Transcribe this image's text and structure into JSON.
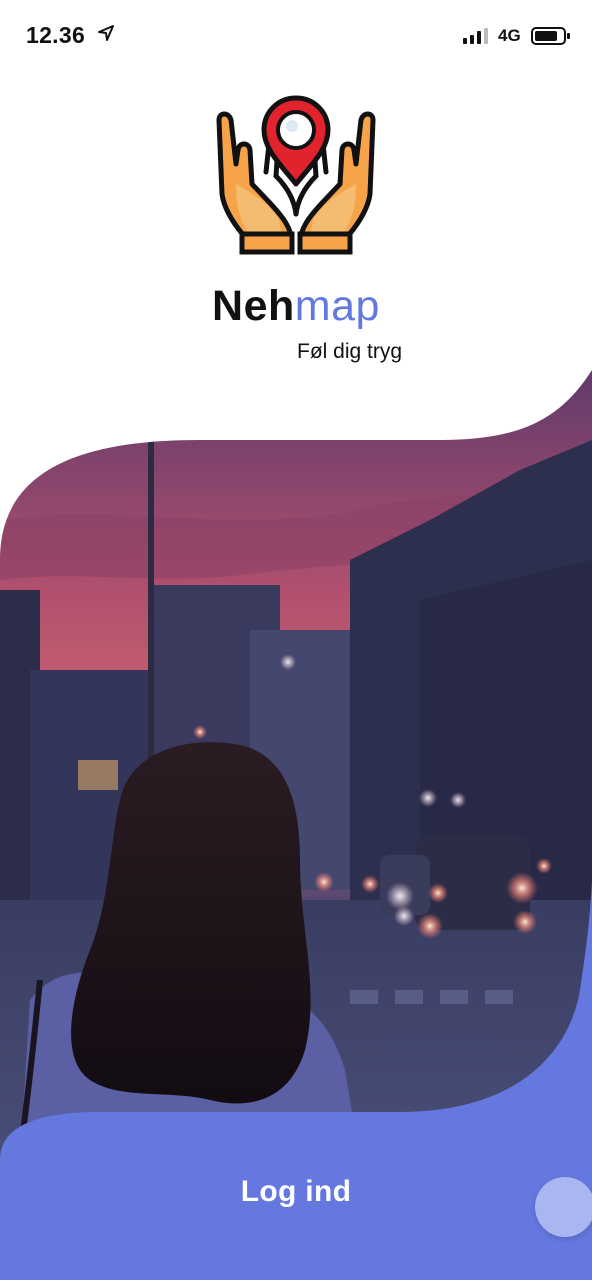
{
  "status_bar": {
    "time": "12.36",
    "network": "4G",
    "icons": [
      "location-arrow-icon",
      "signal-bars-icon",
      "battery-icon"
    ]
  },
  "brand": {
    "name_part1": "Neh",
    "name_part2": "map",
    "tagline": "Føl dig tryg",
    "logo_icon": "hands-holding-map-pin-icon"
  },
  "login": {
    "label": "Log ind"
  },
  "colors": {
    "accent": "#6478e0",
    "accent_light": "#a9b6f0",
    "text": "#111111",
    "background": "#ffffff"
  }
}
